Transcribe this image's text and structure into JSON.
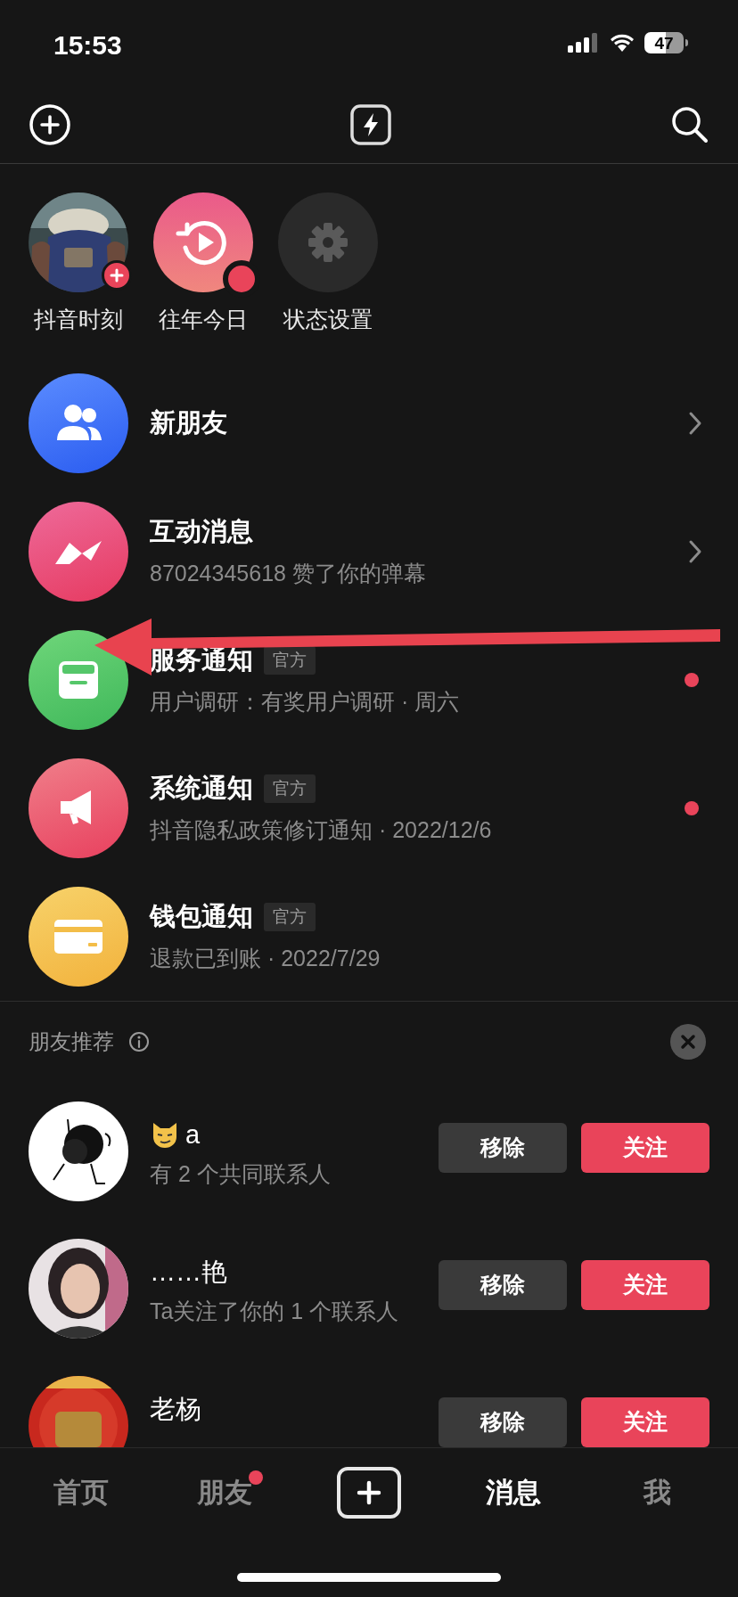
{
  "status_bar": {
    "time": "15:53",
    "battery": "47"
  },
  "stories": [
    {
      "kind": "moment",
      "label": "抖音时刻"
    },
    {
      "kind": "memory",
      "label": "往年今日"
    },
    {
      "kind": "status",
      "label": "状态设置"
    }
  ],
  "messages": [
    {
      "kind": "friends",
      "title": "新朋友",
      "chevron": true,
      "unread": false
    },
    {
      "kind": "interaction",
      "title": "互动消息",
      "subtitle": "87024345618 赞了你的弹幕",
      "chevron": true,
      "unread": false
    },
    {
      "kind": "service",
      "title": "服务通知",
      "badge": "官方",
      "subtitle": "用户调研：有奖用户调研 · 周六",
      "chevron": false,
      "unread": true
    },
    {
      "kind": "system",
      "title": "系统通知",
      "badge": "官方",
      "subtitle": "抖音隐私政策修订通知 · 2022/12/6",
      "chevron": false,
      "unread": true
    },
    {
      "kind": "wallet",
      "title": "钱包通知",
      "badge": "官方",
      "subtitle": "退款已到账 · 2022/7/29",
      "chevron": false,
      "unread": false
    }
  ],
  "recommendations": {
    "title": "朋友推荐",
    "people": [
      {
        "kind": "scribble",
        "name": "a",
        "emoji": true,
        "subtitle": "有 2 个共同联系人",
        "remove": "移除",
        "follow": "关注"
      },
      {
        "kind": "portrait",
        "name": "……艳",
        "emoji": false,
        "subtitle": "Ta关注了你的 1 个联系人",
        "remove": "移除",
        "follow": "关注"
      },
      {
        "kind": "festive",
        "name": "老杨",
        "emoji": false,
        "remove": "移除",
        "follow": "关注"
      }
    ]
  },
  "tab_bar": [
    {
      "kind": "text",
      "label": "首页",
      "selected": false,
      "badge": false
    },
    {
      "kind": "text",
      "label": "朋友",
      "selected": false,
      "badge": true
    },
    {
      "kind": "create",
      "selected": false,
      "badge": false
    },
    {
      "kind": "text",
      "label": "消息",
      "selected": true,
      "badge": false
    },
    {
      "kind": "text",
      "label": "我",
      "selected": false,
      "badge": false
    }
  ]
}
